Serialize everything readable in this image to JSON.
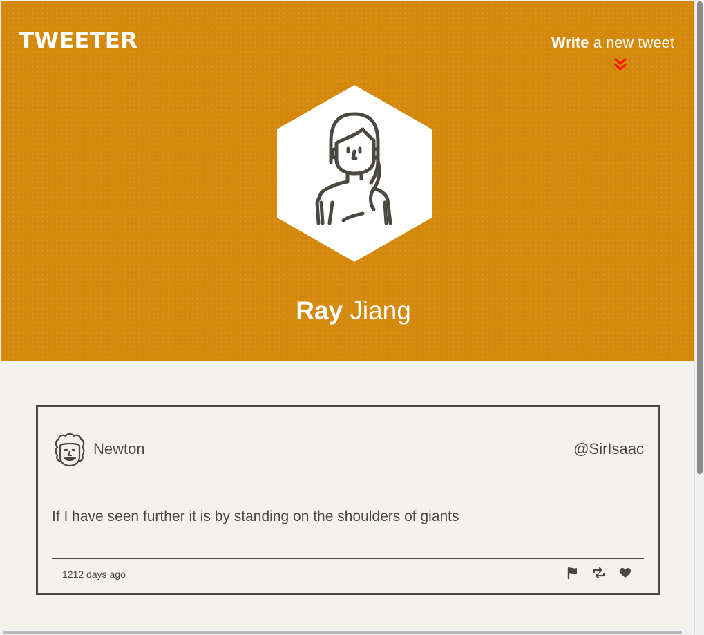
{
  "app": {
    "logo": "TWEETER"
  },
  "compose": {
    "strong": "Write",
    "light": "a new tweet",
    "arrow_icon": "double-chevron-down-icon",
    "arrow_color": "#ff1a00"
  },
  "profile": {
    "first_name": "Ray",
    "last_name": "Jiang",
    "avatar_icon": "woman-avatar-icon"
  },
  "colors": {
    "header_bg": "#d4890c",
    "page_bg": "#f4f2ed",
    "text_dark": "#4b4842"
  },
  "tweets": [
    {
      "name": "Newton",
      "handle": "@SirIsaac",
      "avatar_icon": "newton-avatar-icon",
      "content": "If I have seen further it is by standing on the shoulders of giants",
      "time": "1212 days ago",
      "actions": [
        "flag-icon",
        "retweet-icon",
        "heart-icon"
      ]
    }
  ]
}
